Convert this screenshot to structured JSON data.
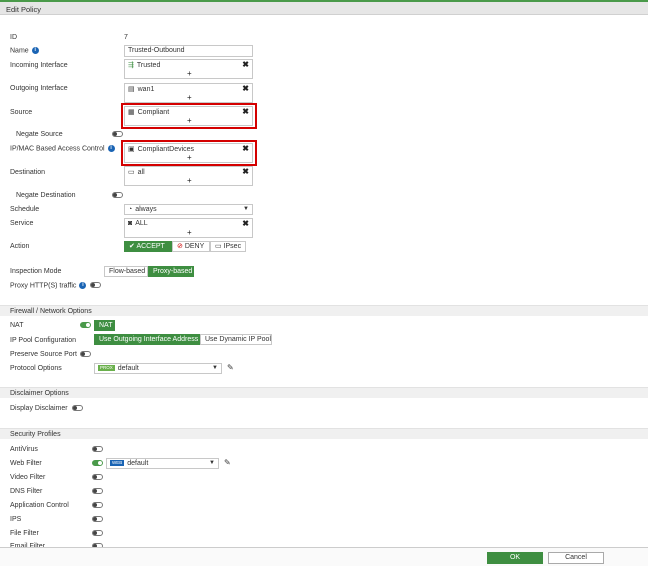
{
  "window": {
    "title": "Edit Policy"
  },
  "form": {
    "id_label": "ID",
    "id_value": "7",
    "name_label": "Name",
    "name_value": "Trusted-Outbound",
    "incoming_label": "Incoming Interface",
    "incoming_value": "Trusted",
    "outgoing_label": "Outgoing Interface",
    "outgoing_value": "wan1",
    "source_label": "Source",
    "source_value": "Compliant",
    "negate_source_label": "Negate Source",
    "ipmac_label": "IP/MAC Based Access Control",
    "ipmac_value": "CompliantDevices",
    "destination_label": "Destination",
    "destination_value": "all",
    "negate_destination_label": "Negate Destination",
    "schedule_label": "Schedule",
    "schedule_value": "always",
    "service_label": "Service",
    "service_value": "ALL",
    "action_label": "Action",
    "action_accept": "ACCEPT",
    "action_deny": "DENY",
    "action_ipsec": "IPsec",
    "inspection_label": "Inspection Mode",
    "inspection_flow": "Flow-based",
    "inspection_proxy": "Proxy-based",
    "proxy_https_label": "Proxy HTTP(S) traffic",
    "plus": "+",
    "remove": "✖"
  },
  "firewall": {
    "section_title": "Firewall / Network Options",
    "nat_label": "NAT",
    "nat_badge": "NAT",
    "ippool_label": "IP Pool Configuration",
    "ippool_outgoing": "Use Outgoing Interface Address",
    "ippool_dynamic": "Use Dynamic IP Pool",
    "preserve_label": "Preserve Source Port",
    "protocol_label": "Protocol Options",
    "protocol_badge": "PROX",
    "protocol_value": "default"
  },
  "disclaimer": {
    "section_title": "Disclaimer Options",
    "display_label": "Display Disclaimer"
  },
  "security": {
    "section_title": "Security Profiles",
    "antivirus_label": "AntiVirus",
    "webfilter_label": "Web Filter",
    "webfilter_badge": "WEB",
    "webfilter_value": "default",
    "video_label": "Video Filter",
    "dns_label": "DNS Filter",
    "app_label": "Application Control",
    "ips_label": "IPS",
    "file_label": "File Filter",
    "email_label": "Email Filter"
  },
  "footer": {
    "ok": "OK",
    "cancel": "Cancel"
  },
  "colors": {
    "accent": "#3e8e41",
    "highlight": "#d40000",
    "info": "#1a64b4"
  }
}
